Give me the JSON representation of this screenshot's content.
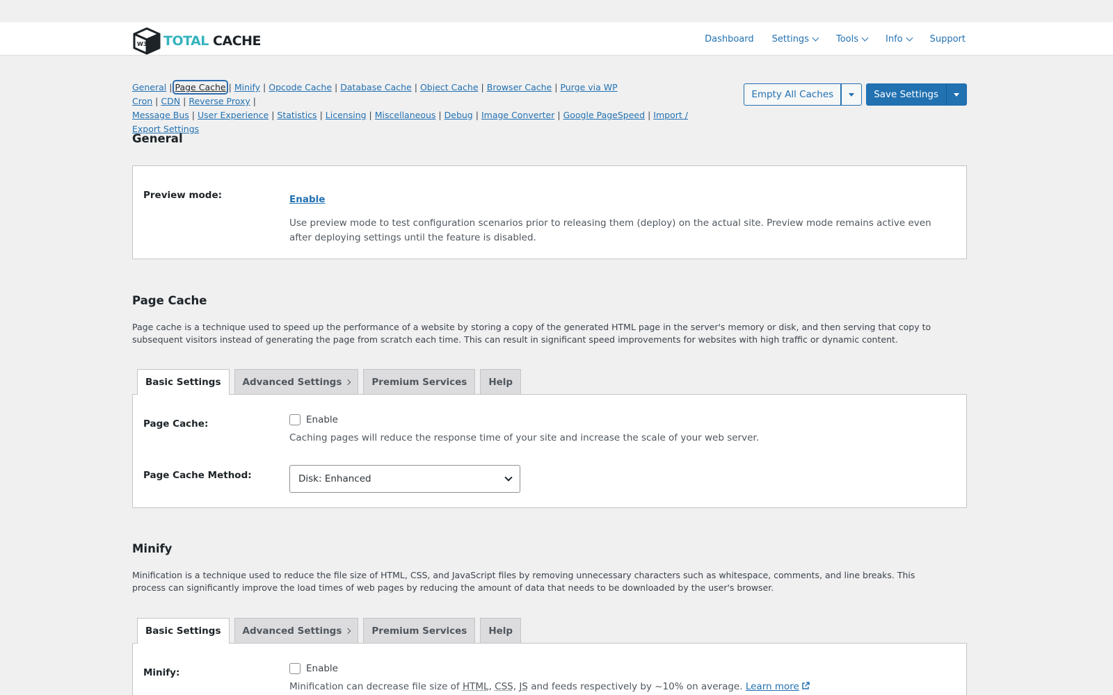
{
  "logo": {
    "text_part1": "TOTAL",
    "text_part2": "CACHE",
    "badge": "W3"
  },
  "topnav": {
    "dashboard": "Dashboard",
    "settings": "Settings",
    "tools": "Tools",
    "info": "Info",
    "support": "Support"
  },
  "sublinks": [
    "General",
    "Page Cache",
    "Minify",
    "Opcode Cache",
    "Database Cache",
    "Object Cache",
    "Browser Cache",
    "Purge via WP Cron",
    "CDN",
    "Reverse Proxy",
    "Message Bus",
    "User Experience",
    "Statistics",
    "Licensing",
    "Miscellaneous",
    "Debug",
    "Image Converter",
    "Google PageSpeed",
    "Import / Export Settings"
  ],
  "actions": {
    "empty_caches": "Empty All Caches",
    "save_settings": "Save Settings"
  },
  "general": {
    "title": "General",
    "preview_label": "Preview mode:",
    "preview_link": "Enable",
    "preview_desc": "Use preview mode to test configuration scenarios prior to releasing them (deploy) on the actual site. Preview mode remains active even after deploying settings until the feature is disabled."
  },
  "page_cache": {
    "title": "Page Cache",
    "description": "Page cache is a technique used to speed up the performance of a website by storing a copy of the generated HTML page in the server's memory or disk, and then serving that copy to subsequent visitors instead of generating the page from scratch each time. This can result in significant speed improvements for websites with high traffic or dynamic content.",
    "tabs": [
      "Basic Settings",
      "Advanced Settings",
      "Premium Services",
      "Help"
    ],
    "enable_label": "Page Cache:",
    "enable_text": "Enable",
    "enable_desc": "Caching pages will reduce the response time of your site and increase the scale of your web server.",
    "method_label": "Page Cache Method:",
    "method_value": "Disk: Enhanced"
  },
  "minify": {
    "title": "Minify",
    "description": "Minification is a technique used to reduce the file size of HTML, CSS, and JavaScript files by removing unnecessary characters such as whitespace, comments, and line breaks. This process can significantly improve the load times of web pages by reducing the amount of data that needs to be downloaded by the user's browser.",
    "tabs": [
      "Basic Settings",
      "Advanced Settings",
      "Premium Services",
      "Help"
    ],
    "enable_label": "Minify:",
    "enable_text": "Enable",
    "desc_prefix": "Minification can decrease file size of",
    "abbr_html": "HTML",
    "abbr_css": "CSS",
    "abbr_js": "JS",
    "desc_suffix": "and feeds respectively by ~10% on average.",
    "learn_more": "Learn more"
  }
}
